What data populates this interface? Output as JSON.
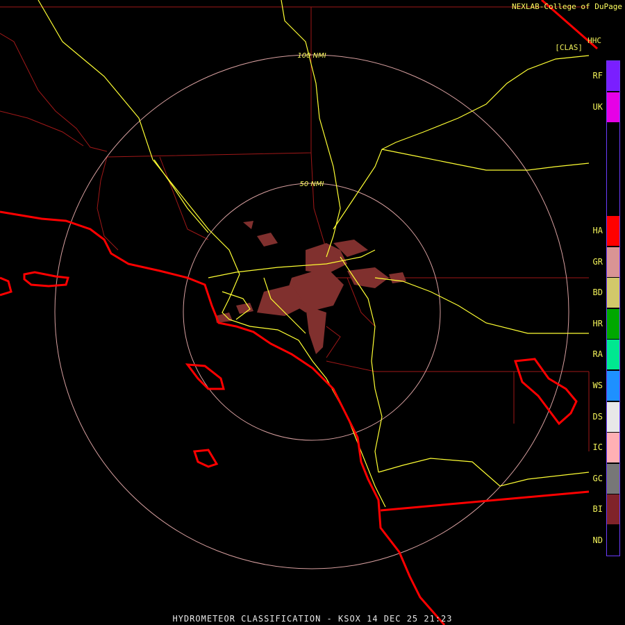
{
  "header": {
    "credit": "NEXLAB-College of DuPage",
    "product_code": "HHC",
    "product_bracket": "[CLAS]"
  },
  "rings": [
    {
      "label": "100 NMI"
    },
    {
      "label": "50 NMI"
    }
  ],
  "legend": [
    {
      "code": "RF",
      "color": "#7a1fff"
    },
    {
      "code": "UK",
      "color": "#e600e6"
    },
    {
      "code": "HA",
      "color": "#ff0000"
    },
    {
      "code": "GR",
      "color": "#d99494"
    },
    {
      "code": "BD",
      "color": "#d2c86a"
    },
    {
      "code": "HR",
      "color": "#00a800"
    },
    {
      "code": "RA",
      "color": "#00e890"
    },
    {
      "code": "WS",
      "color": "#1e90ff"
    },
    {
      "code": "DS",
      "color": "#e8e8e8"
    },
    {
      "code": "IC",
      "color": "#ffb0b4"
    },
    {
      "code": "GC",
      "color": "#777777"
    },
    {
      "code": "BI",
      "color": "#80232a"
    },
    {
      "code": "ND",
      "color": "#000000"
    }
  ],
  "colors": {
    "highway": "#ffff33",
    "county": "#a01818",
    "coast": "#ff0000",
    "ring": "#d8a0a0",
    "echo": "#80302e"
  },
  "footer": "HYDROMETEOR CLASSIFICATION - KSOX 14 DEC 25 21:23"
}
